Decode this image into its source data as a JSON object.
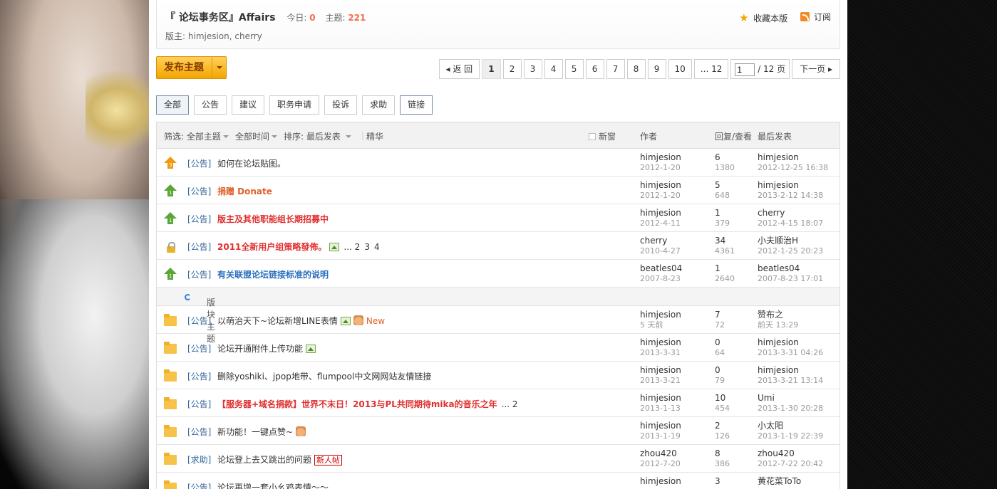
{
  "forum": {
    "title": "『 论坛事务区』Affairs",
    "today_label": "今日:",
    "today_value": "0",
    "topics_label": "主题:",
    "topics_value": "221",
    "mods_label": "版主:",
    "mods": "himjesion, cherry",
    "favorite_label": "收藏本版",
    "subscribe_label": "订阅"
  },
  "toolbar": {
    "post_label": "发布主题",
    "prev_label": "返 回",
    "pages": [
      "1",
      "2",
      "3",
      "4",
      "5",
      "6",
      "7",
      "8",
      "9",
      "10",
      "... 12"
    ],
    "current_page": "1",
    "page_input_value": "1",
    "page_total": "/ 12 页",
    "next_label": "下一页"
  },
  "types": [
    "全部",
    "公告",
    "建议",
    "职务申请",
    "投诉",
    "求助",
    "链接"
  ],
  "thead": {
    "filter_label": "筛选:",
    "filter_all": "全部主题",
    "filter_time": "全部时间",
    "sort_label": "排序:",
    "sort_value": "最后发表",
    "digest": "精华",
    "new_window": "新窗",
    "author": "作者",
    "replies": "回复/查看",
    "last": "最后发表"
  },
  "sticky": [
    {
      "icon": "gold",
      "n": "3",
      "tag": "[公告]",
      "title": "如何在论坛贴图。",
      "style": "",
      "author": "himjesion",
      "adate": "2012-1-20",
      "replies": "6",
      "views": "1380",
      "last": "himjesion",
      "ldate": "2012-12-25 16:38"
    },
    {
      "icon": "green",
      "n": "1",
      "tag": "[公告]",
      "title": "捐赠 Donate",
      "style": "orange",
      "author": "himjesion",
      "adate": "2012-1-20",
      "replies": "5",
      "views": "648",
      "last": "himjesion",
      "ldate": "2013-2-12 14:38"
    },
    {
      "icon": "green",
      "n": "1",
      "tag": "[公告]",
      "title": "版主及其他职能组长期招募中",
      "style": "red",
      "author": "himjesion",
      "adate": "2012-4-11",
      "replies": "1",
      "views": "379",
      "last": "cherry",
      "ldate": "2012-4-15 18:07"
    },
    {
      "icon": "lock",
      "n": "",
      "tag": "[公告]",
      "title": "2011全新用户组策略發佈。",
      "style": "red",
      "author": "cherry",
      "adate": "2010-4-27",
      "replies": "34",
      "views": "4361",
      "last": "小夫顺治H",
      "ldate": "2012-1-25 20:23"
    },
    {
      "icon": "green",
      "n": "1",
      "tag": "[公告]",
      "title": "有关联盟论坛链接标准的说明",
      "style": "blue",
      "author": "beatles04",
      "adate": "2007-8-23",
      "replies": "1",
      "views": "2640",
      "last": "beatles04",
      "ldate": "2007-8-23 17:01"
    }
  ],
  "sticky_pages": [
    "... 2",
    "3",
    "4"
  ],
  "section_label": "版块主题",
  "threads": [
    {
      "tag": "[公告]",
      "title": "以萌治天下~论坛新增LINE表情",
      "style": "",
      "author": "himjesion",
      "adate": "5 天前",
      "replies": "7",
      "views": "72",
      "last": "赞布之",
      "ldate": "前天 13:29",
      "new": "New"
    },
    {
      "tag": "[公告]",
      "title": "论坛开通附件上传功能",
      "style": "",
      "author": "himjesion",
      "adate": "2013-3-31",
      "replies": "0",
      "views": "64",
      "last": "himjesion",
      "ldate": "2013-3-31 04:26"
    },
    {
      "tag": "[公告]",
      "title": "删除yoshiki、jpop地带、flumpool中文网网站友情链接",
      "style": "",
      "author": "himjesion",
      "adate": "2013-3-21",
      "replies": "0",
      "views": "79",
      "last": "himjesion",
      "ldate": "2013-3-21 13:14"
    },
    {
      "tag": "[公告]",
      "title": "【服务器+域名捐款】世界不末日！2013与PL共同期待mika的音乐之年",
      "style": "red",
      "author": "himjesion",
      "adate": "2013-1-13",
      "replies": "10",
      "views": "454",
      "last": "Umi",
      "ldate": "2013-1-30 20:28",
      "pages": "... 2"
    },
    {
      "tag": "[公告]",
      "title": "新功能！一键点赞~",
      "style": "",
      "author": "himjesion",
      "adate": "2013-1-19",
      "replies": "2",
      "views": "126",
      "last": "小太阳",
      "ldate": "2013-1-19 22:39"
    },
    {
      "tag": "[求助]",
      "title": "论坛登上去又跳出的问题",
      "style": "",
      "author": "zhou420",
      "adate": "2012-7-20",
      "replies": "8",
      "views": "386",
      "last": "zhou420",
      "ldate": "2012-7-22 20:42",
      "badge": "新人帖"
    },
    {
      "tag": "[公告]",
      "title": "论坛再增一套小幺鸡表情～～",
      "style": "",
      "author": "himjesion",
      "adate": "",
      "replies": "3",
      "views": "",
      "last": "黄花菜ToTo",
      "ldate": ""
    }
  ]
}
